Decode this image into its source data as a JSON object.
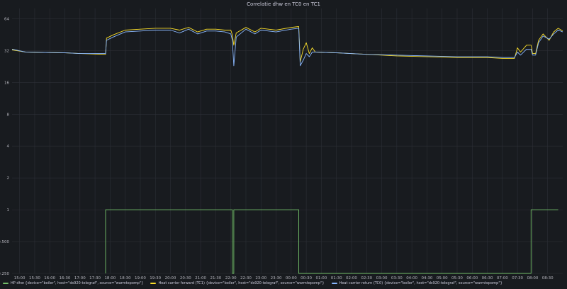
{
  "colors": {
    "background": "#181b1f",
    "grid": "#2c2f36",
    "text": "#ccccdc",
    "axis_text": "#b7b7bf"
  },
  "chart_data": {
    "type": "line",
    "title": "Correlatie dhw en TC0 en TC1",
    "xlabel": "",
    "ylabel": "",
    "y_scale": "log2",
    "ylim": [
      0.25,
      80
    ],
    "y_ticks": [
      "0.250",
      "0.500",
      "1",
      "2",
      "4",
      "8",
      "16",
      "32",
      "64"
    ],
    "y_tick_values": [
      0.25,
      0.5,
      1,
      2,
      4,
      8,
      16,
      32,
      64
    ],
    "x_unit": "hours",
    "x_range": [
      14.75,
      32.0
    ],
    "x_ticks": [
      "15:00",
      "15:30",
      "16:00",
      "16:30",
      "17:00",
      "17:30",
      "18:00",
      "18:30",
      "19:00",
      "19:30",
      "20:00",
      "20:30",
      "21:00",
      "21:30",
      "22:00",
      "22:30",
      "23:00",
      "23:30",
      "00:00",
      "00:30",
      "01:00",
      "01:30",
      "02:00",
      "02:30",
      "03:00",
      "03:30",
      "04:00",
      "04:30",
      "05:00",
      "05:30",
      "06:00",
      "06:30",
      "07:00",
      "07:30",
      "08:00",
      "08:30"
    ],
    "x_tick_values": [
      15,
      15.5,
      16,
      16.5,
      17,
      17.5,
      18,
      18.5,
      19,
      19.5,
      20,
      20.5,
      21,
      21.5,
      22,
      22.5,
      23,
      23.5,
      24,
      24.5,
      25,
      25.5,
      26,
      26.5,
      27,
      27.5,
      28,
      28.5,
      29,
      29.5,
      30,
      30.5,
      31,
      31.5,
      32,
      32.5
    ],
    "grid": true,
    "legend_position": "bottom-left",
    "series": [
      {
        "name": "HP dhw {device=\"boiler\", host=\"ds920-telegraf\", source=\"warmtepomp\"}",
        "color": "#73bf69",
        "points": [
          [
            17.85,
            0.25
          ],
          [
            17.85,
            1
          ],
          [
            22.05,
            1
          ],
          [
            22.05,
            0.25
          ],
          [
            22.1,
            0.25
          ],
          [
            22.1,
            1
          ],
          [
            24.25,
            1
          ],
          [
            24.25,
            0.25
          ],
          [
            31.95,
            0.25
          ],
          [
            31.95,
            1
          ],
          [
            32.85,
            1
          ]
        ]
      },
      {
        "name": "Heat carrier forward (TC1) {device=\"boiler\", host=\"ds920-telegraf\", source=\"warmtepomp\"}",
        "color": "#fade2a",
        "points": [
          [
            14.75,
            32.5
          ],
          [
            15.2,
            31
          ],
          [
            16.5,
            30.5
          ],
          [
            17.0,
            30
          ],
          [
            17.8,
            29.5
          ],
          [
            17.85,
            29.5
          ],
          [
            17.88,
            42
          ],
          [
            18.1,
            45
          ],
          [
            18.5,
            50
          ],
          [
            19.0,
            51
          ],
          [
            19.5,
            52
          ],
          [
            20.0,
            52
          ],
          [
            20.3,
            50
          ],
          [
            20.6,
            53
          ],
          [
            20.9,
            48
          ],
          [
            21.2,
            51
          ],
          [
            21.5,
            51
          ],
          [
            21.8,
            50
          ],
          [
            22.0,
            50
          ],
          [
            22.05,
            45
          ],
          [
            22.1,
            36
          ],
          [
            22.18,
            47
          ],
          [
            22.5,
            53
          ],
          [
            22.8,
            48
          ],
          [
            23.0,
            52
          ],
          [
            23.5,
            50
          ],
          [
            24.0,
            53
          ],
          [
            24.25,
            54
          ],
          [
            24.3,
            25
          ],
          [
            24.4,
            33
          ],
          [
            24.5,
            38
          ],
          [
            24.6,
            30
          ],
          [
            24.7,
            34
          ],
          [
            24.8,
            31
          ],
          [
            25.5,
            30.5
          ],
          [
            26.5,
            29.5
          ],
          [
            27.5,
            28.5
          ],
          [
            28.5,
            28
          ],
          [
            29.5,
            27.5
          ],
          [
            30.5,
            27.5
          ],
          [
            31.0,
            27
          ],
          [
            31.4,
            27
          ],
          [
            31.5,
            34
          ],
          [
            31.6,
            31
          ],
          [
            31.8,
            36
          ],
          [
            31.95,
            36
          ],
          [
            32.0,
            30
          ],
          [
            32.1,
            30
          ],
          [
            32.2,
            40
          ],
          [
            32.35,
            46
          ],
          [
            32.55,
            40
          ],
          [
            32.7,
            48
          ],
          [
            32.85,
            52
          ],
          [
            33.0,
            49
          ]
        ]
      },
      {
        "name": "Heat carrier return (TC0) {device=\"boiler\", host=\"ds920-telegraf\", source=\"warmtepomp\"}",
        "color": "#8ab8ff",
        "points": [
          [
            14.75,
            33
          ],
          [
            15.2,
            31
          ],
          [
            16.5,
            30.5
          ],
          [
            17.0,
            30
          ],
          [
            17.8,
            30
          ],
          [
            17.85,
            30
          ],
          [
            17.88,
            40
          ],
          [
            18.1,
            43
          ],
          [
            18.5,
            48
          ],
          [
            19.0,
            49
          ],
          [
            19.5,
            50
          ],
          [
            20.0,
            50
          ],
          [
            20.3,
            47
          ],
          [
            20.6,
            51
          ],
          [
            20.9,
            46
          ],
          [
            21.2,
            49
          ],
          [
            21.5,
            49
          ],
          [
            21.8,
            48
          ],
          [
            22.0,
            46
          ],
          [
            22.05,
            40
          ],
          [
            22.1,
            23
          ],
          [
            22.18,
            43
          ],
          [
            22.5,
            51
          ],
          [
            22.8,
            46
          ],
          [
            23.0,
            50
          ],
          [
            23.5,
            48
          ],
          [
            24.0,
            51
          ],
          [
            24.25,
            52
          ],
          [
            24.3,
            23
          ],
          [
            24.4,
            26
          ],
          [
            24.5,
            30
          ],
          [
            24.6,
            28
          ],
          [
            24.7,
            31
          ],
          [
            24.8,
            31
          ],
          [
            25.5,
            30.5
          ],
          [
            26.5,
            29.5
          ],
          [
            27.5,
            29
          ],
          [
            28.5,
            28.5
          ],
          [
            29.5,
            28
          ],
          [
            30.5,
            28
          ],
          [
            31.0,
            27.5
          ],
          [
            31.4,
            27.5
          ],
          [
            31.5,
            31
          ],
          [
            31.6,
            29
          ],
          [
            31.8,
            33
          ],
          [
            31.95,
            33
          ],
          [
            32.0,
            29
          ],
          [
            32.1,
            29
          ],
          [
            32.2,
            38
          ],
          [
            32.35,
            44
          ],
          [
            32.55,
            41
          ],
          [
            32.7,
            46
          ],
          [
            32.85,
            50
          ],
          [
            33.0,
            48
          ]
        ]
      }
    ]
  }
}
